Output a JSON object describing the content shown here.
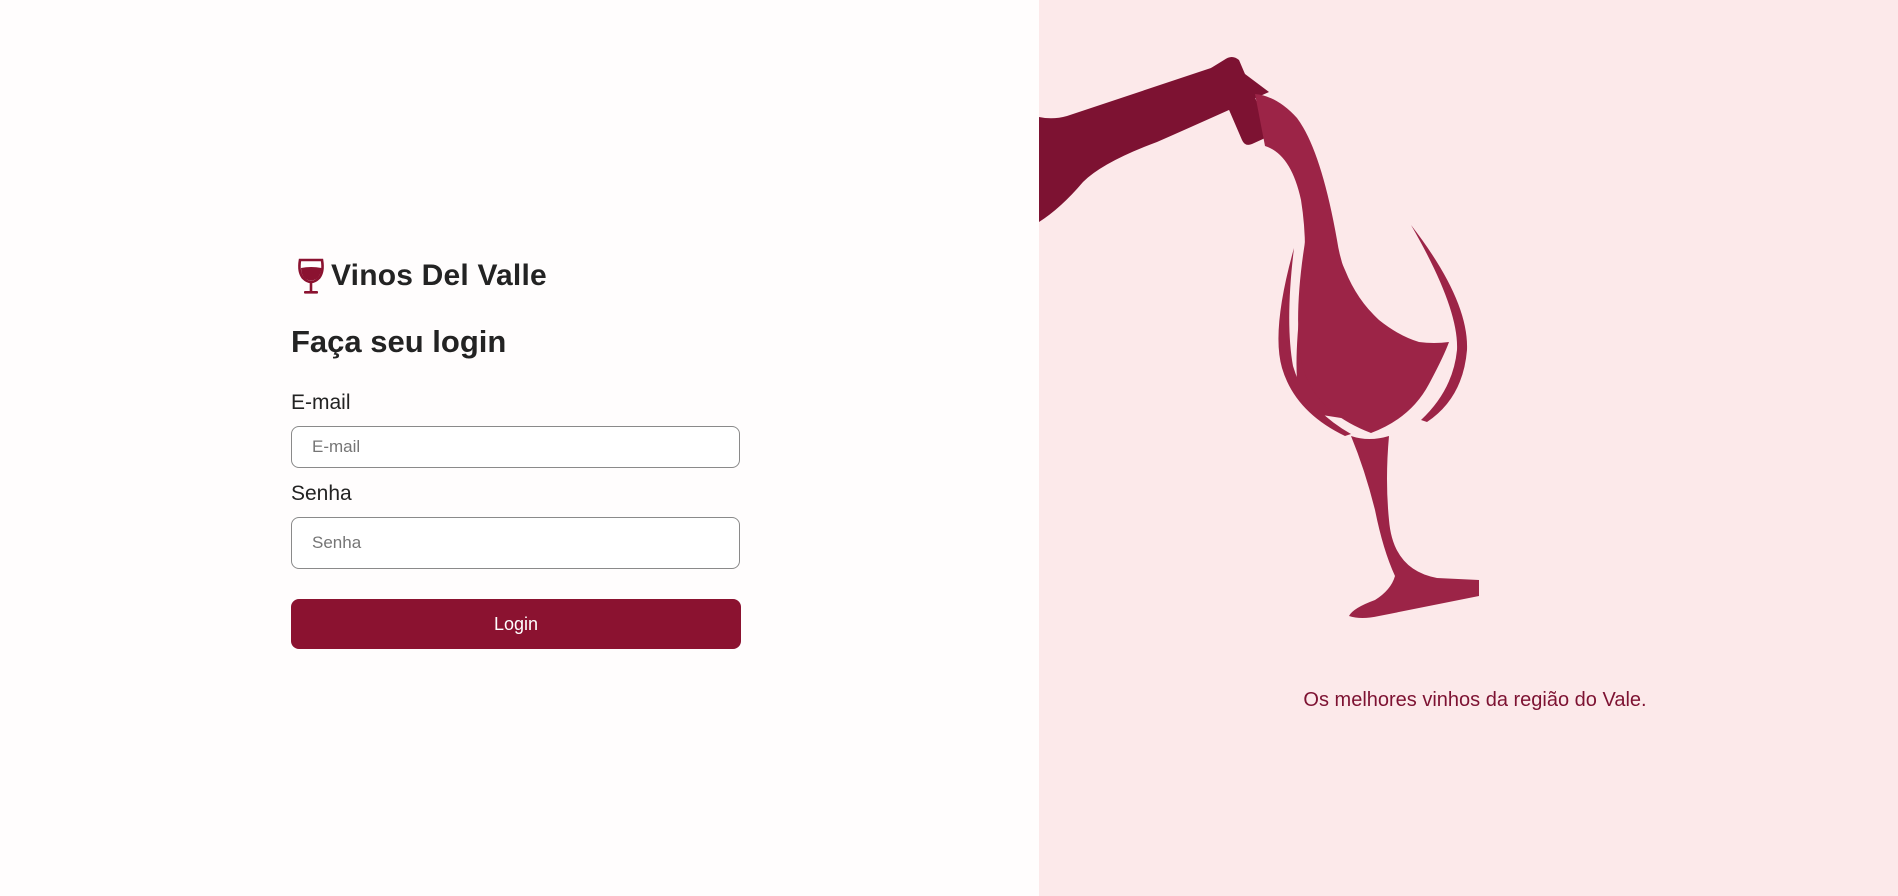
{
  "brand": {
    "icon": "wine-glass-icon",
    "name": "Vinos Del Valle"
  },
  "login": {
    "title": "Faça seu login",
    "email_label": "E-mail",
    "email_placeholder": "E-mail",
    "email_value": "",
    "password_label": "Senha",
    "password_placeholder": "Senha",
    "password_value": "",
    "button_label": "Login"
  },
  "hero": {
    "illustration": "wine-bottle-pouring-into-glass-icon",
    "tagline": "Os melhores vinhos da região do Vale."
  },
  "colors": {
    "accent": "#8b1230",
    "accent_dark": "#7d1232",
    "wine_light": "#9c2447",
    "right_background": "#fce9ea",
    "left_background": "#fffdfd",
    "text": "#232323"
  }
}
